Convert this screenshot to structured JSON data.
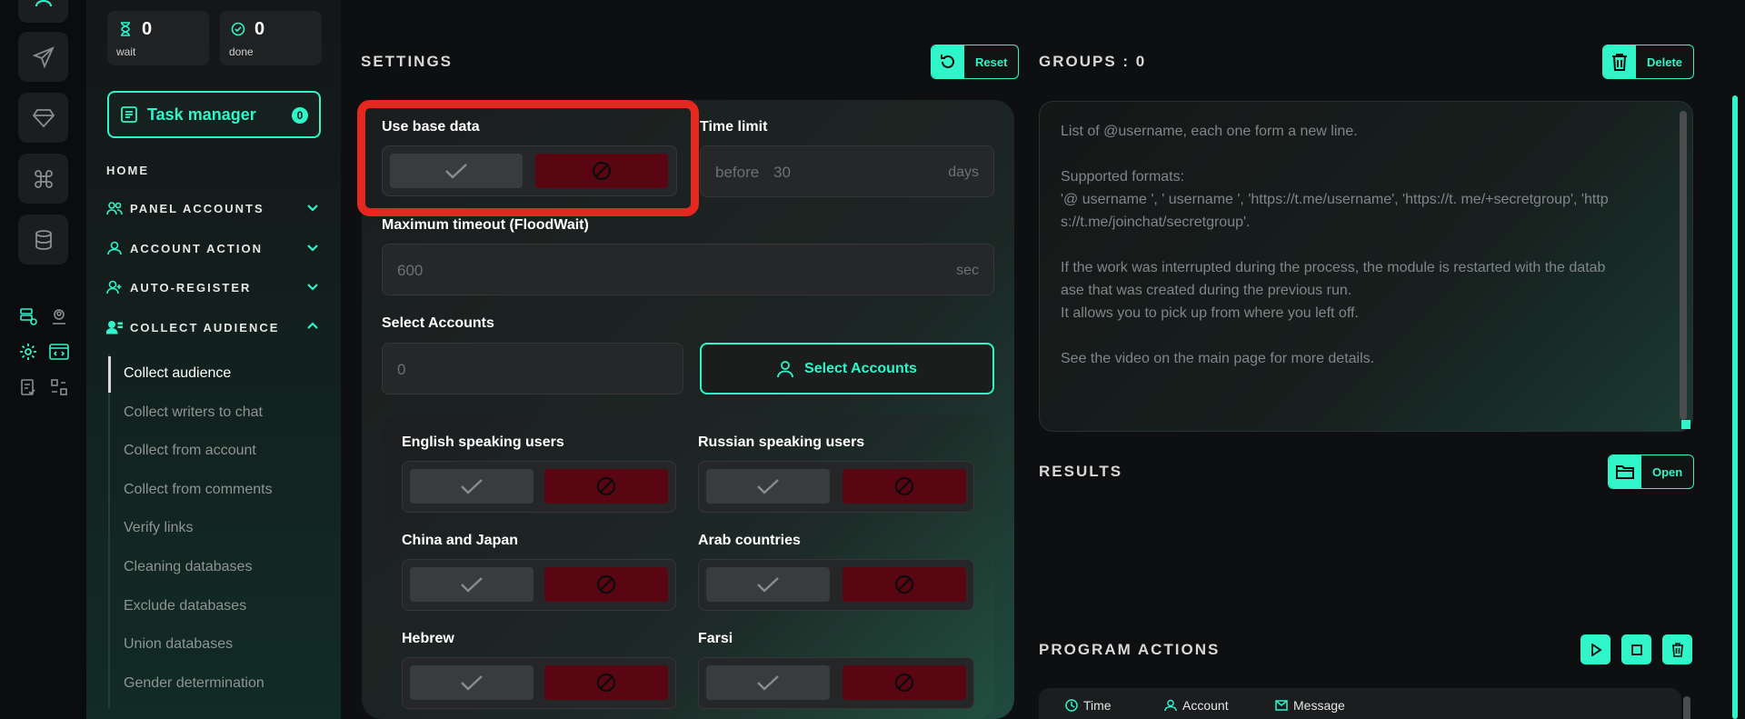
{
  "stats": {
    "wait": {
      "value": "0",
      "label": "wait"
    },
    "done": {
      "value": "0",
      "label": "done"
    }
  },
  "task_manager": {
    "label": "Task manager",
    "count": "0"
  },
  "nav": {
    "home": "HOME",
    "sections": [
      {
        "label": "PANEL ACCOUNTS",
        "icon": "users-icon"
      },
      {
        "label": "ACCOUNT ACTION",
        "icon": "user-icon"
      },
      {
        "label": "AUTO-REGISTER",
        "icon": "user-plus-icon"
      },
      {
        "label": "COLLECT AUDIENCE",
        "icon": "user-list-icon"
      }
    ],
    "sub_items": [
      "Collect audience",
      "Collect writers to chat",
      "Collect from account",
      "Collect from comments",
      "Verify links",
      "Cleaning databases",
      "Exclude databases",
      "Union databases",
      "Gender determination"
    ]
  },
  "settings": {
    "title": "SETTINGS",
    "reset_label": "Reset",
    "use_base_data": "Use base data",
    "time_limit": {
      "label": "Time limit",
      "prefix": "before",
      "placeholder": "30",
      "unit": "days"
    },
    "max_timeout": {
      "label": "Maximum timeout (FloodWait)",
      "placeholder": "600",
      "unit": "sec"
    },
    "select_accounts": {
      "label": "Select Accounts",
      "placeholder": "0",
      "button": "Select Accounts"
    },
    "filters": [
      "English speaking users",
      "Russian speaking users",
      "China and Japan",
      "Arab countries",
      "Hebrew",
      "Farsi"
    ]
  },
  "groups": {
    "title": "GROUPS : 0",
    "delete_label": "Delete",
    "placeholder_lines": [
      "List of @username, each one form a new line.",
      "",
      "Supported formats:",
      "'@ username ', ' username ', 'https://t.me/username', 'https://t. me/+secretgroup', 'http",
      "s://t.me/joinchat/secretgroup'.",
      "",
      "If the work was interrupted during the process, the module is restarted with the datab",
      "ase that was created during the previous run.",
      "It allows you to pick up from where you left off.",
      "",
      "See the video on the main page for more details."
    ]
  },
  "results": {
    "title": "RESULTS",
    "open_label": "Open"
  },
  "program_actions": {
    "title": "PROGRAM ACTIONS",
    "columns": [
      "Time",
      "Account",
      "Message"
    ]
  },
  "colors": {
    "accent": "#2ff5c9",
    "danger": "#5a0612",
    "highlight": "#e5281f"
  }
}
